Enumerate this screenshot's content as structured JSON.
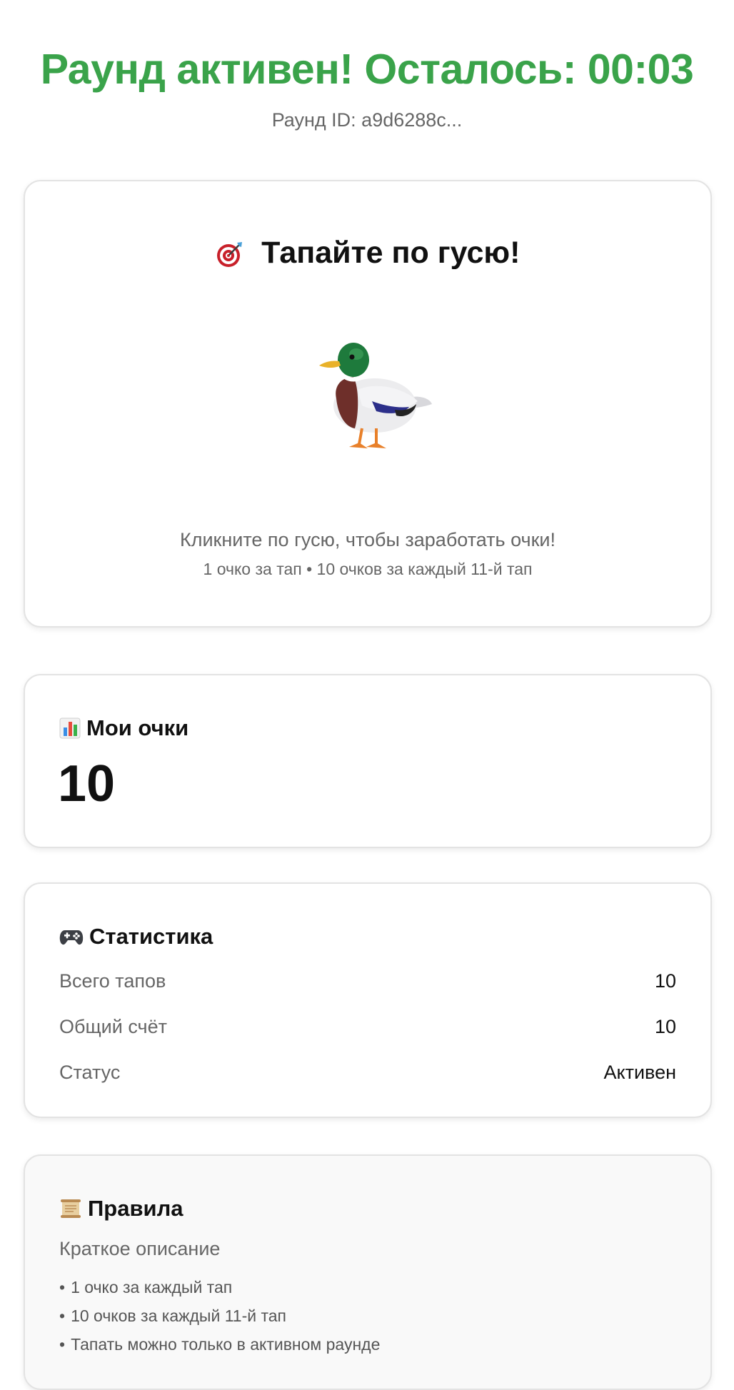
{
  "header": {
    "round_status": "Раунд активен! Осталось: 00:03",
    "round_id": "Раунд ID: a9d6288c..."
  },
  "game": {
    "heading": "Тапайте по гусю!",
    "heading_icon": "target-icon",
    "target_icon": "duck-icon",
    "hint": "Кликните по гусю, чтобы заработать очки!",
    "subhint": "1 очко за тап • 10 очков за каждый 11-й тап"
  },
  "score": {
    "title": "Мои очки",
    "icon": "bar-chart-icon",
    "value": "10"
  },
  "stats": {
    "title": "Статистика",
    "icon": "gamepad-icon",
    "rows": [
      {
        "label": "Всего тапов",
        "value": "10"
      },
      {
        "label": "Общий счёт",
        "value": "10"
      },
      {
        "label": "Статус",
        "value": "Активен"
      }
    ]
  },
  "rules": {
    "title": "Правила",
    "icon": "scroll-icon",
    "subtitle": "Краткое описание",
    "items": [
      "1 очко за каждый тап",
      "10 очков за каждый 11-й тап",
      "Тапать можно только в активном раунде"
    ]
  },
  "colors": {
    "accent": "#3aa34a",
    "muted_text": "#666666",
    "card_border": "#e3e3e3"
  }
}
